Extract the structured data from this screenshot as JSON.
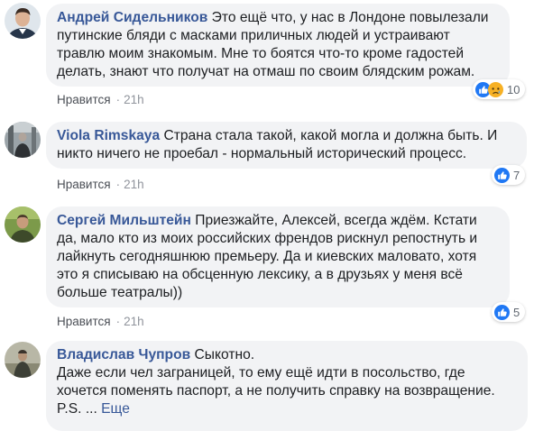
{
  "comments": [
    {
      "author": "Андрей Сидельников",
      "text": "Это ещё что, у нас в Лондоне повылезали путинские бляди с масками приличных людей и устраивают травлю моим знакомым. Мне то боятся что-то кроме гадостей делать, знают что получат на отмаш по своим блядским рожам.",
      "like_label": "Нравится",
      "time": "21h",
      "reactions": [
        "like-icon",
        "sad-icon"
      ],
      "reaction_count": "10"
    },
    {
      "author": "Viola Rimskaya",
      "text": "Страна стала такой, какой могла и должна быть. И никто ничего не проебал - нормальный исторический процесс.",
      "like_label": "Нравится",
      "time": "21h",
      "reactions": [
        "like-icon"
      ],
      "reaction_count": "7"
    },
    {
      "author": "Сергей Мильштейн",
      "text": "Приезжайте, Алексей, всегда ждём. Кстати да, мало кто из моих российских френдов рискнул репостнуть и лайкнуть сегодняшнюю премьеру. Да и киевских маловато, хотя это я списываю на обсценную лексику, а в друзьях у меня всё больше театралы))",
      "like_label": "Нравится",
      "time": "21h",
      "reactions": [
        "like-icon"
      ],
      "reaction_count": "5"
    },
    {
      "author": "Владислав Чупров",
      "text_line1": "Сыкотно.",
      "text_line2": "Даже если чел заграницей, то ему ещё идти в посольство, где хочется поменять паспорт, а не получить справку на возвращение.",
      "text_tail": "P.S.",
      "ellipsis": "...",
      "see_more": "Еще"
    }
  ],
  "colors": {
    "author": "#385898",
    "bubble": "#f2f3f5",
    "meta": "#90949c",
    "like_blue": "#2078f4",
    "sad_yellow": "#f7b125"
  }
}
